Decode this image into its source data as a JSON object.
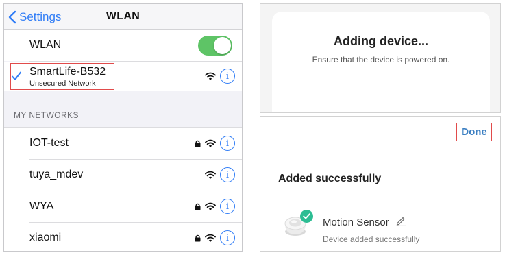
{
  "wlan_screen": {
    "back_label": "Settings",
    "title": "WLAN",
    "wlan_row_label": "WLAN",
    "wlan_enabled": true,
    "connected_network": {
      "name": "SmartLife-B532",
      "subtitle": "Unsecured Network"
    },
    "section_header": "MY NETWORKS",
    "networks": [
      {
        "name": "IOT-test",
        "locked": true
      },
      {
        "name": "tuya_mdev",
        "locked": false
      },
      {
        "name": "WYA",
        "locked": true
      },
      {
        "name": "xiaomi",
        "locked": true
      }
    ],
    "info_glyph": "i"
  },
  "adding_screen": {
    "title": "Adding device...",
    "subtitle": "Ensure that the device is powered on."
  },
  "added_screen": {
    "done_label": "Done",
    "title": "Added successfully",
    "device_name": "Motion Sensor",
    "device_status": "Device added successfully"
  },
  "colors": {
    "ios_blue": "#2f7cf6",
    "toggle_green": "#5ec466",
    "highlight_red": "#e14b4b",
    "done_blue": "#3c7fc2",
    "success_green": "#2cbd93"
  }
}
